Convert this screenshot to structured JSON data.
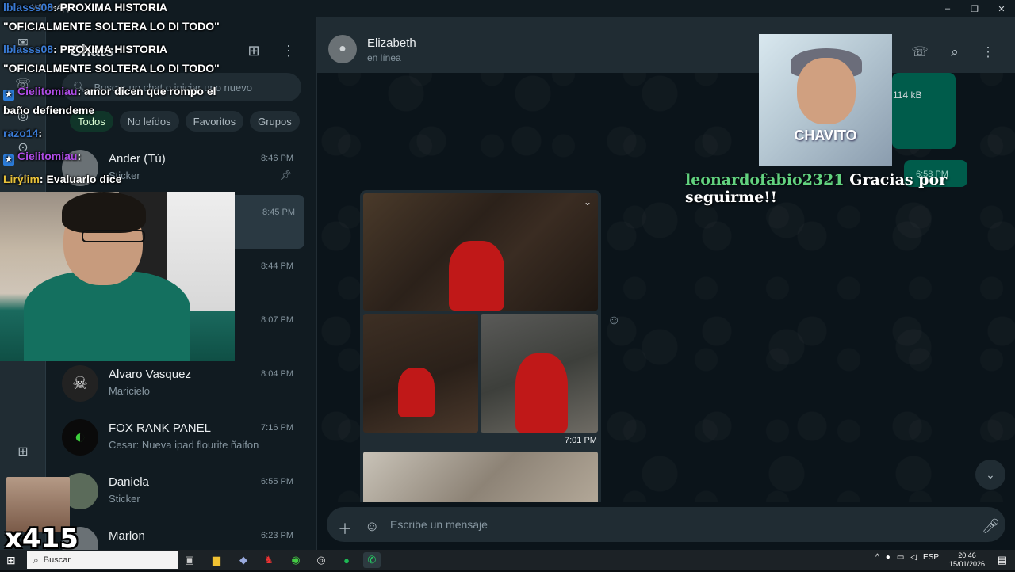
{
  "window": {
    "title": "WhatsApp",
    "controls": [
      "–",
      "❐",
      "✕"
    ]
  },
  "chatlist": {
    "title": "Chats",
    "search_placeholder": "Buscar un chat o iniciar uno nuevo",
    "filters": [
      "Todos",
      "No leídos",
      "Favoritos",
      "Grupos"
    ],
    "rows": [
      {
        "name": "Ander (Tú)",
        "sub": "Sticker",
        "time": "8:46 PM"
      },
      {
        "name": "",
        "sub": "",
        "time": "8:45 PM"
      },
      {
        "name": "",
        "sub": "",
        "time": "8:44 PM"
      },
      {
        "name": "",
        "sub": "",
        "time": "8:07 PM"
      },
      {
        "name": "Alvaro Vasquez",
        "sub": "Maricielo",
        "time": "8:04 PM"
      },
      {
        "name": "FOX RANK PANEL",
        "sub": "Cesar: Nueva ipad flourite ñaifon",
        "time": "7:16 PM"
      },
      {
        "name": "Daniela",
        "sub": "Sticker",
        "time": "6:55 PM"
      },
      {
        "name": "Marlon",
        "sub": "",
        "time": "6:23 PM"
      }
    ]
  },
  "chat": {
    "contact_name": "Elizabeth",
    "status": "en línea",
    "file_size": "114 kB",
    "out_time": "6:58 PM",
    "image_time": "7:01 PM",
    "composer_placeholder": "Escribe un mensaje"
  },
  "stream": {
    "chat_messages": [
      {
        "user": "lblasss08",
        "text": ": PROXIMA HISTORIA",
        "color": "#3a7bd5"
      },
      {
        "user": "",
        "text": "\"OFICIALMENTE SOLTERA LO DI TODO\"",
        "color": "#ffffff"
      },
      {
        "user": "lblasss08",
        "text": ": PROXIMA HISTORIA",
        "color": "#3a7bd5"
      },
      {
        "user": "",
        "text": "\"OFICIALMENTE SOLTERA LO DI TODO\"",
        "color": "#ffffff"
      },
      {
        "user": "Cielitomiau",
        "text": ": amor dicen que rompo el",
        "color": "#b04de8"
      },
      {
        "user": "",
        "text": "baño defiendeme",
        "color": "#ffffff"
      },
      {
        "user": "razo14",
        "text": ":",
        "color": "#3a7bd5"
      },
      {
        "user": "Cielitomiau",
        "text": ":",
        "color": "#b04de8"
      },
      {
        "user": "Lirylim",
        "text": ": Evaluarlo dice",
        "color": "#e8c23a"
      }
    ],
    "combo_label": "x415",
    "alert_label": "CHAVITO",
    "alert_user": "leonardofabio2321",
    "alert_text": "Gracias por seguirme!!"
  },
  "taskbar": {
    "search_label": "Buscar",
    "lang": "ESP",
    "time": "20:46",
    "date": "15/01/2026"
  },
  "colors": {
    "accent": "#00a884",
    "panel": "#202c33",
    "bg": "#111b21"
  }
}
